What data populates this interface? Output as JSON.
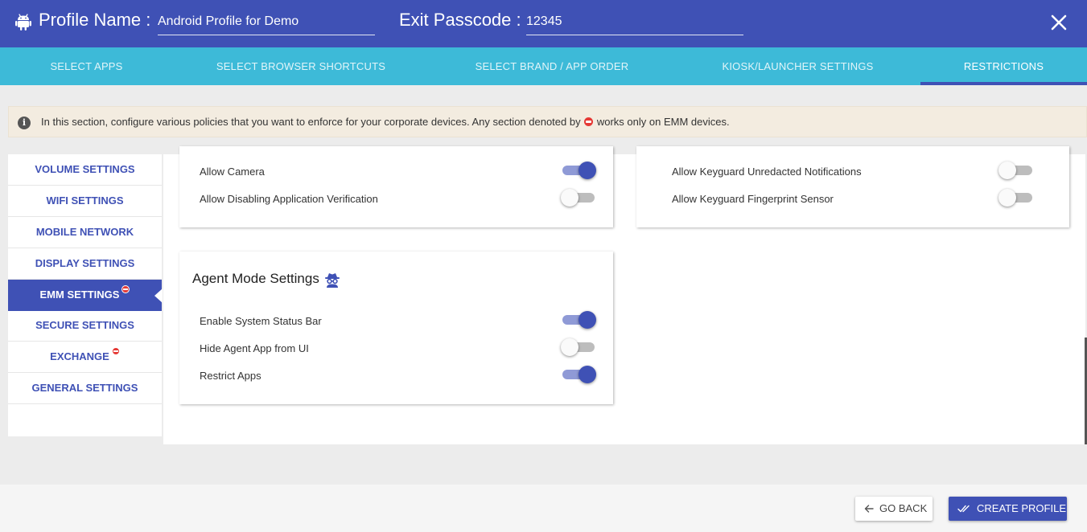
{
  "header": {
    "profile_name_label": "Profile Name :",
    "profile_name_value": "Android Profile for Demo",
    "exit_passcode_label": "Exit Passcode :",
    "exit_passcode_value": "12345",
    "icon": "android-icon",
    "close_icon": "close-icon"
  },
  "tabs": [
    {
      "label": "SELECT APPS"
    },
    {
      "label": "SELECT BROWSER SHORTCUTS"
    },
    {
      "label": "SELECT BRAND / APP ORDER"
    },
    {
      "label": "KIOSK/LAUNCHER SETTINGS"
    },
    {
      "label": "RESTRICTIONS",
      "active": true
    }
  ],
  "info": {
    "text_before": "In this section, configure various policies that you want to enforce for your corporate devices. Any section denoted by",
    "text_after": "works only on EMM devices.",
    "icon": "info-icon"
  },
  "sidebar": {
    "items": [
      {
        "label": "VOLUME SETTINGS"
      },
      {
        "label": "WIFI SETTINGS"
      },
      {
        "label": "MOBILE NETWORK"
      },
      {
        "label": "DISPLAY SETTINGS"
      },
      {
        "label": "EMM SETTINGS",
        "active": true,
        "emm": true
      },
      {
        "label": "SECURE SETTINGS"
      },
      {
        "label": "EXCHANGE",
        "emm": true
      },
      {
        "label": "GENERAL SETTINGS"
      }
    ]
  },
  "main": {
    "left_card_rows": [
      {
        "label": "Allow Camera",
        "enabled": true
      },
      {
        "label": "Allow Disabling Application Verification",
        "enabled": false
      }
    ],
    "right_card_rows": [
      {
        "label": "Allow Keyguard Unredacted Notifications",
        "enabled": false
      },
      {
        "label": "Allow Keyguard Fingerprint Sensor",
        "enabled": false
      }
    ],
    "agent_card": {
      "title": "Agent Mode Settings",
      "icon": "agent-icon",
      "rows": [
        {
          "label": "Enable System Status Bar",
          "enabled": true
        },
        {
          "label": "Hide Agent App from UI",
          "enabled": false
        },
        {
          "label": "Restrict Apps",
          "enabled": true
        }
      ]
    }
  },
  "footer": {
    "go_back_label": "GO BACK",
    "create_profile_label": "CREATE PROFILE"
  },
  "colors": {
    "primary": "#3f51b5",
    "tab_bar": "#3dbad8",
    "emm_badge": "#e53935",
    "info_bg": "#f3ece0"
  }
}
